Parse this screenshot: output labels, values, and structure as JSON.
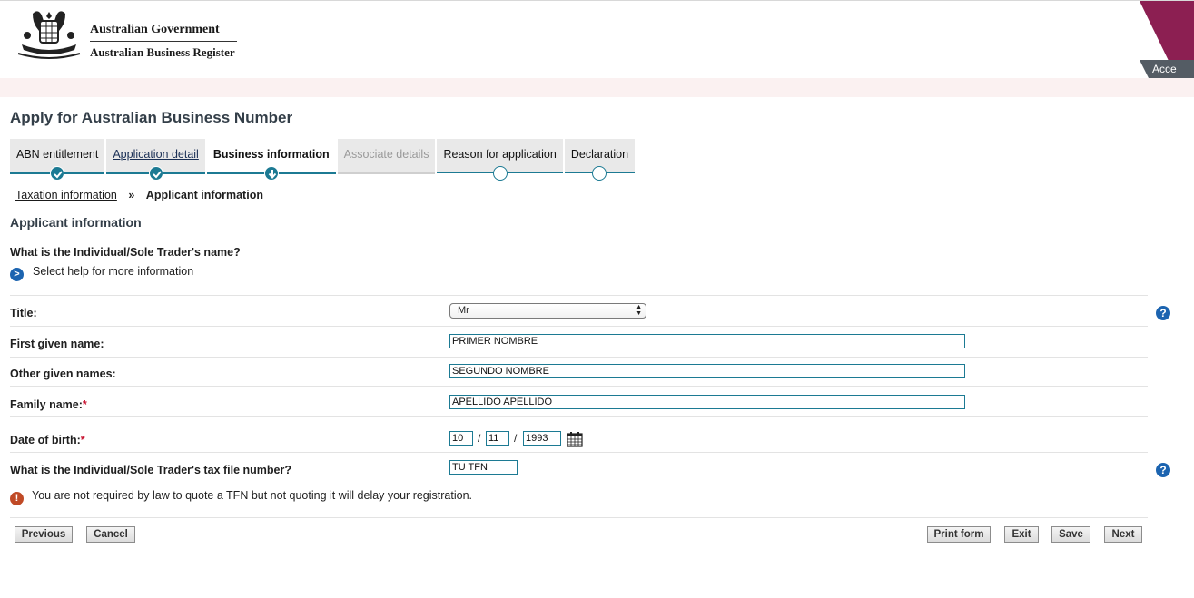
{
  "header": {
    "gov_title": "Australian Government",
    "gov_subtitle": "Australian Business Register",
    "accessibility_tab": "Acce",
    "brand_color": "#8c1f52"
  },
  "page_title": "Apply for Australian Business Number",
  "steps": [
    {
      "label": "ABN entitlement",
      "status": "complete"
    },
    {
      "label": "Application detail",
      "status": "complete"
    },
    {
      "label": "Business information",
      "status": "current"
    },
    {
      "label": "Associate details",
      "status": "disabled"
    },
    {
      "label": "Reason for application",
      "status": "pending"
    },
    {
      "label": "Declaration",
      "status": "pending"
    }
  ],
  "breadcrumb": {
    "parent": "Taxation information",
    "separator": "»",
    "current": "Applicant information"
  },
  "section_heading": "Applicant information",
  "question_name": "What is the Individual/Sole Trader's name?",
  "help_link": "Select help for more information",
  "form": {
    "title_label": "Title:",
    "title_value": "Mr",
    "first_name_label": "First given name:",
    "first_name_value": "PRIMER NOMBRE",
    "other_names_label": "Other given names:",
    "other_names_value": "SEGUNDO NOMBRE",
    "family_name_label": "Family name:",
    "family_name_value": "APELLIDO APELLIDO",
    "required_marker": "*",
    "dob_label": "Date of birth:",
    "dob_day": "10",
    "dob_month": "11",
    "dob_year": "1993",
    "dob_separator": "/",
    "tfn_label": "What is the Individual/Sole Trader's tax file number?",
    "tfn_value": "TU TFN",
    "help_icon": "?"
  },
  "warning": "You are not required by law to quote a TFN but not quoting it will delay your registration.",
  "buttons": {
    "previous": "Previous",
    "cancel": "Cancel",
    "print": "Print form",
    "exit": "Exit",
    "save": "Save",
    "next": "Next"
  }
}
